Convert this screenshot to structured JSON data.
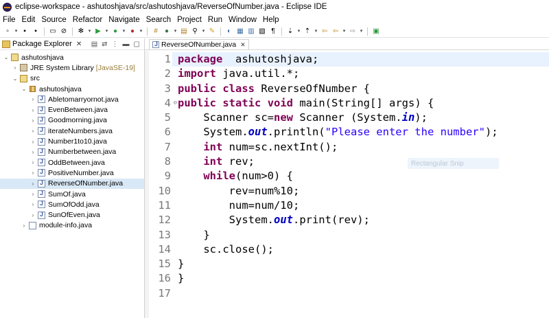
{
  "window": {
    "title": "eclipse-workspace - ashutoshjava/src/ashutoshjava/ReverseOfNumber.java - Eclipse IDE"
  },
  "menu": [
    "File",
    "Edit",
    "Source",
    "Refactor",
    "Navigate",
    "Search",
    "Project",
    "Run",
    "Window",
    "Help"
  ],
  "explorer": {
    "title": "Package Explorer",
    "close": "✕",
    "tree": [
      {
        "label": "ashutoshjava",
        "note": "",
        "icon": "project",
        "indent": 0,
        "arrow": "⌄"
      },
      {
        "label": "JRE System Library",
        "note": "[JavaSE-19]",
        "icon": "lib",
        "indent": 1,
        "arrow": "›"
      },
      {
        "label": "src",
        "note": "",
        "icon": "src",
        "indent": 1,
        "arrow": "⌄"
      },
      {
        "label": "ashutoshjava",
        "note": "",
        "icon": "pkg",
        "indent": 2,
        "arrow": "⌄"
      },
      {
        "label": "Abletomarryornot.java",
        "note": "",
        "icon": "java",
        "indent": 3,
        "arrow": "›"
      },
      {
        "label": "EvenBetween.java",
        "note": "",
        "icon": "java",
        "indent": 3,
        "arrow": "›"
      },
      {
        "label": "Goodmorning.java",
        "note": "",
        "icon": "java",
        "indent": 3,
        "arrow": "›"
      },
      {
        "label": "iterateNumbers.java",
        "note": "",
        "icon": "java",
        "indent": 3,
        "arrow": "›"
      },
      {
        "label": "Number1to10.java",
        "note": "",
        "icon": "java",
        "indent": 3,
        "arrow": "›"
      },
      {
        "label": "Numberbetween.java",
        "note": "",
        "icon": "java",
        "indent": 3,
        "arrow": "›"
      },
      {
        "label": "OddBetween.java",
        "note": "",
        "icon": "java",
        "indent": 3,
        "arrow": "›"
      },
      {
        "label": "PositiveNumber.java",
        "note": "",
        "icon": "java",
        "indent": 3,
        "arrow": "›"
      },
      {
        "label": "ReverseOfNumber.java",
        "note": "",
        "icon": "java",
        "indent": 3,
        "arrow": "›",
        "selected": true
      },
      {
        "label": "SumOf.java",
        "note": "",
        "icon": "java",
        "indent": 3,
        "arrow": "›"
      },
      {
        "label": "SumOfOdd.java",
        "note": "",
        "icon": "java",
        "indent": 3,
        "arrow": "›"
      },
      {
        "label": "SunOfEven.java",
        "note": "",
        "icon": "java",
        "indent": 3,
        "arrow": "›"
      },
      {
        "label": "module-info.java",
        "note": "",
        "icon": "modinfo",
        "indent": 2,
        "arrow": "›"
      }
    ]
  },
  "editor": {
    "tab": {
      "label": "ReverseOfNumber.java",
      "close": "✕"
    },
    "ghost_label": "Rectangular Snip",
    "lines": [
      [
        [
          "kw",
          "package"
        ],
        [
          "",
          "  ashutoshjava;"
        ]
      ],
      [
        [
          "kw",
          "import"
        ],
        [
          "",
          " java.util.*;"
        ]
      ],
      [
        [
          "kw",
          "public"
        ],
        [
          "",
          " "
        ],
        [
          "kw",
          "class"
        ],
        [
          "",
          " ReverseOfNumber {"
        ]
      ],
      [
        [
          "kw",
          "public"
        ],
        [
          "",
          " "
        ],
        [
          "kw",
          "static"
        ],
        [
          "",
          " "
        ],
        [
          "kw",
          "void"
        ],
        [
          "",
          " main(String[] args) {"
        ]
      ],
      [
        [
          "",
          "    Scanner sc="
        ],
        [
          "kw",
          "new"
        ],
        [
          "",
          " Scanner (System."
        ],
        [
          "fld",
          "in"
        ],
        [
          "",
          ");"
        ]
      ],
      [
        [
          "",
          "    System."
        ],
        [
          "fld",
          "out"
        ],
        [
          "",
          ".println("
        ],
        [
          "str",
          "\"Please enter the number\""
        ],
        [
          "",
          ");"
        ]
      ],
      [
        [
          "",
          "    "
        ],
        [
          "kw",
          "int"
        ],
        [
          "",
          " num=sc.nextInt();"
        ]
      ],
      [
        [
          "",
          "    "
        ],
        [
          "kw",
          "int"
        ],
        [
          "",
          " rev;"
        ]
      ],
      [
        [
          "",
          "    "
        ],
        [
          "kw",
          "while"
        ],
        [
          "",
          "(num>0) {"
        ]
      ],
      [
        [
          "",
          "        rev=num%10;"
        ]
      ],
      [
        [
          "",
          "        num=num/10;"
        ]
      ],
      [
        [
          "",
          "        System."
        ],
        [
          "fld",
          "out"
        ],
        [
          "",
          ".print(rev);"
        ]
      ],
      [
        [
          "",
          "    }"
        ]
      ],
      [
        [
          "",
          "    sc.close();"
        ]
      ],
      [
        [
          "",
          "}"
        ]
      ],
      [
        [
          "",
          "}"
        ]
      ],
      [
        [
          "",
          ""
        ]
      ]
    ],
    "line_numbers": [
      "1",
      "2",
      "3",
      "4",
      "5",
      "6",
      "7",
      "8",
      "9",
      "10",
      "11",
      "12",
      "13",
      "14",
      "15",
      "16",
      "17"
    ],
    "fold_line": "4",
    "fold_glyph": "⊖",
    "current_line": 1
  }
}
